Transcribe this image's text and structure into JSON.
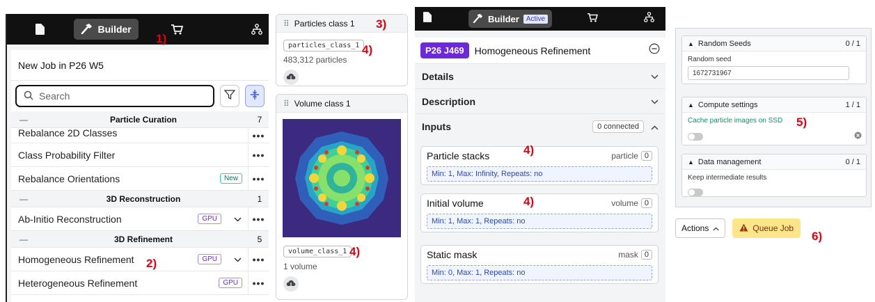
{
  "panel1": {
    "tabs": {
      "builder": "Builder"
    },
    "new_job_title": "New Job in P26 W5",
    "search_placeholder": "Search",
    "categories": [
      {
        "title": "Particle Curation",
        "count": "7"
      },
      {
        "title": "3D Reconstruction",
        "count": "1"
      },
      {
        "title": "3D Refinement",
        "count": "5"
      }
    ],
    "jobs": [
      {
        "label": "Rebalance 2D Classes"
      },
      {
        "label": "Class Probability Filter"
      },
      {
        "label": "Rebalance Orientations",
        "badge": "New"
      },
      {
        "label": "Ab-Initio Reconstruction",
        "badge": "GPU"
      },
      {
        "label": "Homogeneous Refinement",
        "badge": "GPU"
      },
      {
        "label": "Heterogeneous Refinement",
        "badge": "GPU"
      }
    ],
    "more_glyph": "•••"
  },
  "panel2": {
    "particles": {
      "title": "Particles class 1",
      "tag": "particles_class_1",
      "count": "483,312 particles"
    },
    "volume": {
      "title": "Volume class 1",
      "tag": "volume_class_1",
      "count": "1 volume"
    }
  },
  "panel3": {
    "tabs": {
      "builder": "Builder",
      "active": "Active"
    },
    "job_tag": "P26 J469",
    "job_title": "Homogeneous Refinement",
    "sections": {
      "details": "Details",
      "description": "Description",
      "inputs": "Inputs"
    },
    "inputs_connected": "0 connected",
    "inputs": [
      {
        "name": "Particle stacks",
        "type": "particle",
        "count": "0",
        "constraint": "Min: 1, Max: Infinity, Repeats: no"
      },
      {
        "name": "Initial volume",
        "type": "volume",
        "count": "0",
        "constraint": "Min: 1, Max: 1, Repeats: no"
      },
      {
        "name": "Static mask",
        "type": "mask",
        "count": "0",
        "constraint": "Min: 0, Max: 1, Repeats: no"
      }
    ]
  },
  "panel4": {
    "random_seeds": {
      "title": "Random Seeds",
      "count": "0 / 1",
      "field_label": "Random seed",
      "field_value": "1672731967"
    },
    "compute": {
      "title": "Compute settings",
      "count": "1 / 1",
      "option": "Cache particle images on SSD"
    },
    "data_mgmt": {
      "title": "Data management",
      "count": "0 / 1",
      "option": "Keep intermediate results"
    },
    "actions_label": "Actions",
    "queue_label": "Queue Job"
  },
  "annotations": [
    "1)",
    "2)",
    "3)",
    "4)",
    "4)",
    "4)",
    "4)",
    "5)",
    "6)"
  ],
  "colors": {
    "accent_purple": "#6d28d9",
    "annotation_red": "#e3000f",
    "queue_button": "#fde68a",
    "link_green": "#059669"
  }
}
